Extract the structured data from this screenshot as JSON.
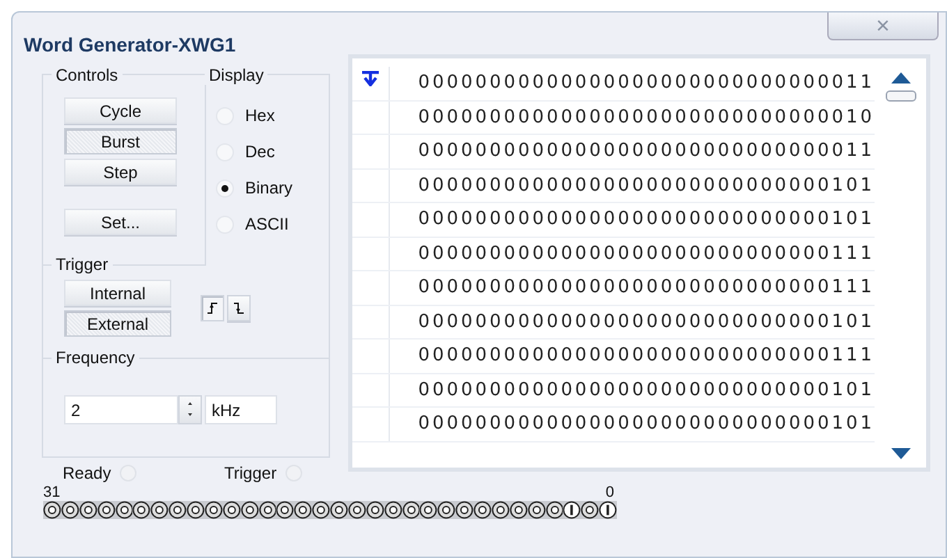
{
  "window": {
    "title": "Word Generator-XWG1",
    "close": "×"
  },
  "controls": {
    "label": "Controls",
    "buttons": [
      {
        "label": "Cycle",
        "selected": false
      },
      {
        "label": "Burst",
        "selected": true
      },
      {
        "label": "Step",
        "selected": false
      }
    ],
    "set_button": "Set..."
  },
  "display": {
    "label": "Display",
    "options": [
      {
        "label": "Hex",
        "selected": false
      },
      {
        "label": "Dec",
        "selected": false
      },
      {
        "label": "Binary",
        "selected": true
      },
      {
        "label": "ASCII",
        "selected": false
      }
    ]
  },
  "trigger": {
    "label": "Trigger",
    "buttons": [
      {
        "label": "Internal",
        "selected": false
      },
      {
        "label": "External",
        "selected": true
      }
    ],
    "edges": [
      {
        "kind": "rising",
        "selected": true
      },
      {
        "kind": "falling",
        "selected": false
      }
    ]
  },
  "frequency": {
    "label": "Frequency",
    "value": "2",
    "unit": "kHz"
  },
  "words": [
    {
      "value": "00000000000000000000000000000011",
      "marker": true
    },
    {
      "value": "00000000000000000000000000000010",
      "marker": false
    },
    {
      "value": "00000000000000000000000000000011",
      "marker": false
    },
    {
      "value": "00000000000000000000000000000101",
      "marker": false
    },
    {
      "value": "00000000000000000000000000000101",
      "marker": false
    },
    {
      "value": "00000000000000000000000000000111",
      "marker": false
    },
    {
      "value": "00000000000000000000000000000111",
      "marker": false
    },
    {
      "value": "00000000000000000000000000000101",
      "marker": false
    },
    {
      "value": "00000000000000000000000000000111",
      "marker": false
    },
    {
      "value": "00000000000000000000000000000101",
      "marker": false
    },
    {
      "value": "00000000000000000000000000000101",
      "marker": false
    }
  ],
  "status": [
    {
      "label": "Ready"
    },
    {
      "label": "Trigger"
    }
  ],
  "terminals": {
    "high_label": "31",
    "low_label": "0",
    "pins": [
      false,
      false,
      false,
      false,
      false,
      false,
      false,
      false,
      false,
      false,
      false,
      false,
      false,
      false,
      false,
      false,
      false,
      false,
      false,
      false,
      false,
      false,
      false,
      false,
      false,
      false,
      false,
      false,
      false,
      true,
      false,
      true
    ]
  }
}
